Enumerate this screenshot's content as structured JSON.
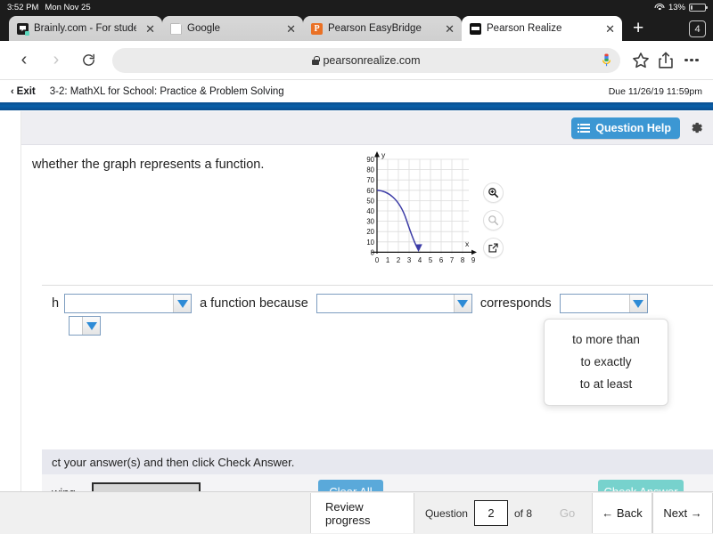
{
  "statusbar": {
    "time": "3:52 PM",
    "date": "Mon Nov 25",
    "battery_percent": "13%",
    "wifi_icon": "wifi-icon",
    "battery_icon": "battery-icon"
  },
  "browser": {
    "tabs": [
      {
        "title": "Brainly.com - For students",
        "favicon": "brainly-icon",
        "active": false,
        "close_label": "✕"
      },
      {
        "title": "Google",
        "favicon": "document-icon",
        "active": false,
        "close_label": "✕"
      },
      {
        "title": "Pearson EasyBridge",
        "favicon": "pearson-p-icon",
        "active": false,
        "close_label": "✕"
      },
      {
        "title": "Pearson Realize",
        "favicon": "realize-icon",
        "active": true,
        "close_label": "✕"
      }
    ],
    "new_tab_label": "+",
    "tab_count": "4",
    "back_label": "‹",
    "forward_label": "›",
    "reload_icon": "reload-icon",
    "url": "pearsonrealize.com",
    "lock_icon": "lock-icon",
    "mic_icon": "microphone-icon",
    "star_icon": "bookmark-star-icon",
    "share_icon": "share-icon",
    "more_icon": "more-options-icon"
  },
  "pearson_header": {
    "exit_label": "Exit",
    "exit_chevron": "‹",
    "assignment_title": "3-2: MathXL for School: Practice & Problem Solving",
    "due_text": "Due 11/26/19 11:59pm"
  },
  "toolbar": {
    "question_help_label": "Question Help",
    "list_icon": "list-icon",
    "gear_icon": "gear-icon",
    "accent_blue": "#3c97d3"
  },
  "question": {
    "prompt_visible": "whether the graph represents a function.",
    "answer": {
      "lead_fragment": "h",
      "dropdown1_value": "",
      "mid_fragment": "a function because",
      "dropdown2_value": "",
      "mid_fragment2": "corresponds",
      "dropdown3_value": "",
      "dropdown4_value": ""
    },
    "open_dropdown_options": [
      "to more than",
      "to exactly",
      "to at least"
    ],
    "graph_tools": [
      {
        "name": "zoom-in-icon",
        "state": "enabled"
      },
      {
        "name": "zoom-out-icon",
        "state": "disabled"
      },
      {
        "name": "pop-out-icon",
        "state": "enabled"
      }
    ]
  },
  "chart_data": {
    "type": "line",
    "title": "",
    "xlabel": "x",
    "ylabel": "y",
    "xlim": [
      0,
      9.8
    ],
    "ylim": [
      0,
      96
    ],
    "xticks": [
      "0",
      "1",
      "2",
      "3",
      "4",
      "5",
      "6",
      "7",
      "8",
      "9"
    ],
    "yticks": [
      "0",
      "10",
      "20",
      "30",
      "40",
      "50",
      "60",
      "70",
      "80",
      "90"
    ],
    "grid": true,
    "legend": "none",
    "series": [
      {
        "name": "curve",
        "color": "#3b3ba6",
        "arrow_end": true,
        "points": [
          [
            0.0,
            60
          ],
          [
            0.4,
            59.4
          ],
          [
            0.8,
            57.6
          ],
          [
            1.2,
            54.6
          ],
          [
            1.6,
            50.4
          ],
          [
            2.0,
            45.0
          ],
          [
            2.4,
            38.4
          ],
          [
            2.8,
            30.6
          ],
          [
            3.2,
            21.6
          ],
          [
            3.5,
            13.9
          ],
          [
            3.8,
            2.0
          ]
        ]
      }
    ]
  },
  "instructions": {
    "text": "ct your answer(s) and then click Check Answer."
  },
  "bottom_strip": {
    "label": "wing",
    "clear_all_label": "Clear All",
    "check_answer_label": "Check Answer",
    "clear_color": "#5aa9da",
    "check_color": "#77d2cd"
  },
  "bottomnav": {
    "review_label": "Review progress",
    "question_label": "Question",
    "question_number": "2",
    "of_label": "of 8",
    "go_label": "Go",
    "back_label": "Back",
    "back_arrow": "←",
    "next_label": "Next",
    "next_arrow": "→"
  }
}
